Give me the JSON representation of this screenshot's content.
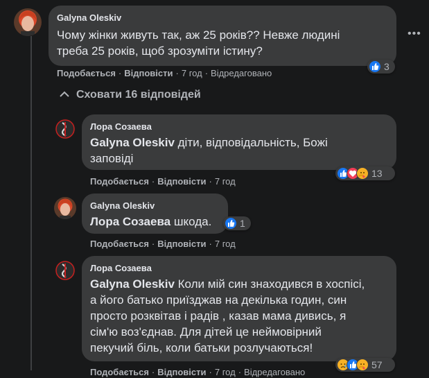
{
  "comments": [
    {
      "author": "Galyna Oleskiv",
      "text": "Чому жінки живуть так, аж 25 років?? Невже людині треба 25 років, щоб зрозуміти істину?",
      "line1": "Чому жінки живуть так, аж 25 років?? Невже людині",
      "line2": "треба 25 років, щоб зрозуміти істину?",
      "like_label": "Подобається",
      "reply_label": "Відповісти",
      "time": "7 год",
      "edited": "Відредаговано",
      "reactions": [
        "like"
      ],
      "reaction_count": "3"
    }
  ],
  "hide_replies_label": "Сховати 16 відповідей",
  "replies": [
    {
      "author": "Лора Созаева",
      "mention": "Galyna Oleskiv",
      "line1": " діти, відповідальність, Божі",
      "line2": "заповіді",
      "like_label": "Подобається",
      "reply_label": "Відповісти",
      "time": "7 год",
      "reactions": [
        "like",
        "love",
        "care"
      ],
      "reaction_count": "13"
    },
    {
      "author": "Galyna Oleskiv",
      "mention": "Лора Созаева",
      "line1": " шкода.",
      "like_label": "Подобається",
      "reply_label": "Відповісти",
      "time": "7 год",
      "reactions": [
        "like"
      ],
      "reaction_count": "1"
    },
    {
      "author": "Лора Созаева",
      "mention": "Galyna Oleskiv",
      "line1": " Коли мій син знаходився в хоспісі,",
      "line2": "а його батько приїзджав на декілька годин, син",
      "line3": "просто розквітав і радів , казав мама дивись, я",
      "line4": "сім'ю воз'єднав. Для дітей це неймовірний",
      "line5": "пекучий біль, коли батьки розлучаються!",
      "like_label": "Подобається",
      "reply_label": "Відповісти",
      "time": "7 год",
      "edited": "Відредаговано",
      "reactions": [
        "sad",
        "like",
        "care"
      ],
      "reaction_count": "57"
    }
  ],
  "colors": {
    "background": "#18191a",
    "bubble": "#3a3b3c",
    "like": "#1877f2",
    "love": "#f33e58",
    "care": "#f7b125",
    "secondary_text": "#b0b3b8"
  }
}
